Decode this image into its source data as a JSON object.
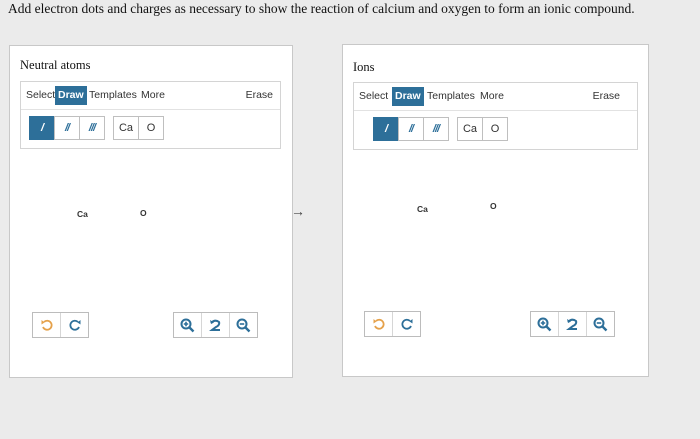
{
  "question": "Add electron dots and charges as necessary to show the reaction of calcium and oxygen to form an ionic compound.",
  "arrow": "→",
  "colors": {
    "accent": "#2d6f99",
    "icon": "#2d6f99",
    "undo_disabled": "#e5a14a"
  },
  "panels": [
    {
      "title": "Neutral atoms",
      "menu": {
        "select": "Select",
        "draw": "Draw",
        "templates": "Templates",
        "more": "More",
        "erase": "Erase"
      },
      "tools": {
        "single_bond": "/",
        "double_bond": "//",
        "triple_bond": "///",
        "ca": "Ca",
        "o": "O"
      },
      "atoms": {
        "ca": "Ca",
        "o": "O"
      },
      "controls": {
        "undo": "undo-icon",
        "redo": "redo-icon",
        "zoom_in": "zoom-in-icon",
        "reset": "reset-icon",
        "zoom_out": "zoom-out-icon"
      }
    },
    {
      "title": "Ions",
      "menu": {
        "select": "Select",
        "draw": "Draw",
        "templates": "Templates",
        "more": "More",
        "erase": "Erase"
      },
      "tools": {
        "single_bond": "/",
        "double_bond": "//",
        "triple_bond": "///",
        "ca": "Ca",
        "o": "O"
      },
      "atoms": {
        "ca": "Ca",
        "o": "O"
      },
      "controls": {
        "undo": "undo-icon",
        "redo": "redo-icon",
        "zoom_in": "zoom-in-icon",
        "reset": "reset-icon",
        "zoom_out": "zoom-out-icon"
      }
    }
  ]
}
